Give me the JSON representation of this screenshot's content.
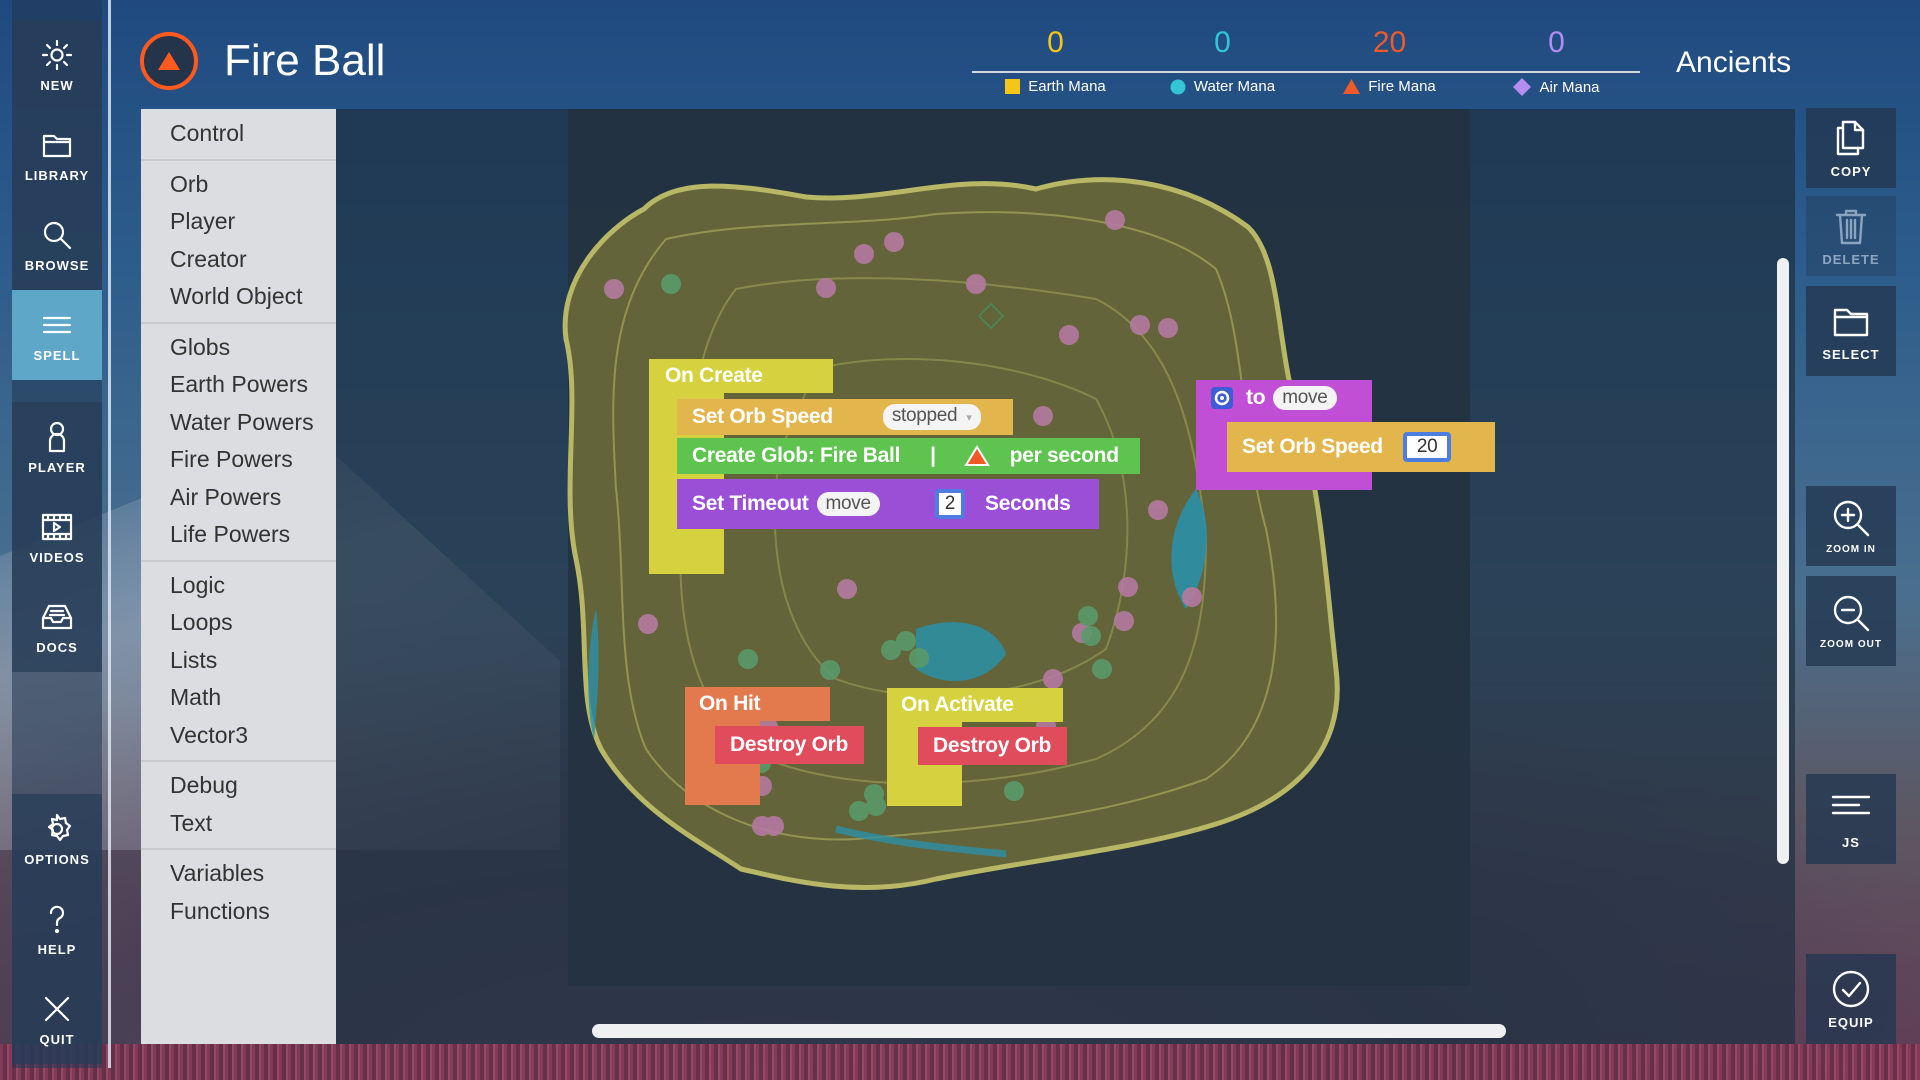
{
  "nav": {
    "top": [
      {
        "label": "NEW",
        "icon": "sun-icon"
      },
      {
        "label": "LIBRARY",
        "icon": "folder-icon"
      },
      {
        "label": "BROWSE",
        "icon": "search-icon"
      },
      {
        "label": "SPELL",
        "icon": "menu-icon"
      }
    ],
    "middle": [
      {
        "label": "PLAYER",
        "icon": "person-icon"
      },
      {
        "label": "VIDEOS",
        "icon": "film-icon"
      },
      {
        "label": "DOCS",
        "icon": "inbox-icon"
      }
    ],
    "bottom": [
      {
        "label": "OPTIONS",
        "icon": "gear-icon"
      },
      {
        "label": "HELP",
        "icon": "question-icon"
      },
      {
        "label": "QUIT",
        "icon": "close-icon"
      }
    ]
  },
  "spell": {
    "title": "Fire Ball"
  },
  "mana": [
    {
      "value": "0",
      "label": "Earth Mana",
      "color": "#f5c518"
    },
    {
      "value": "0",
      "label": "Water Mana",
      "color": "#33c4d6"
    },
    {
      "value": "20",
      "label": "Fire Mana",
      "color": "#f05a28"
    },
    {
      "value": "0",
      "label": "Air Mana",
      "color": "#b58cf0"
    }
  ],
  "faction": "Ancients",
  "categories": [
    [
      "Control"
    ],
    [
      "Orb",
      "Player",
      "Creator",
      "World Object"
    ],
    [
      "Globs",
      "Earth Powers",
      "Water Powers",
      "Fire Powers",
      "Air Powers",
      "Life Powers"
    ],
    [
      "Logic",
      "Loops",
      "Lists",
      "Math",
      "Vector3"
    ],
    [
      "Debug",
      "Text"
    ],
    [
      "Variables",
      "Functions"
    ]
  ],
  "blocks": {
    "on_create": {
      "label": "On Create",
      "set_orb_speed": "Set Orb Speed",
      "speed_option": "stopped",
      "create_glob": "Create Glob: Fire Ball",
      "per_second": "per second",
      "set_timeout": "Set Timeout",
      "timeout_var": "move",
      "timeout_value": "2",
      "seconds": "Seconds"
    },
    "function_move": {
      "to": "to",
      "name": "move",
      "set_orb_speed": "Set Orb Speed",
      "speed_value": "20"
    },
    "on_hit": {
      "label": "On Hit",
      "action": "Destroy Orb"
    },
    "on_activate": {
      "label": "On Activate",
      "action": "Destroy Orb"
    }
  },
  "tools": {
    "copy": "COPY",
    "delete": "DELETE",
    "select": "SELECT",
    "zoom_in": "ZOOM IN",
    "zoom_out": "ZOOM OUT",
    "js": "JS",
    "equip": "EQUIP"
  },
  "colors": {
    "control_hat": "#d6d23f",
    "orb_block": "#e3b64d",
    "glob_block": "#5ec44f",
    "timeout_block": "#9a4fd6",
    "function_block": "#c14fd6",
    "on_hit": "#e27a4e",
    "destroy": "#e04c5b",
    "active_nav": "#5fa7c8"
  }
}
